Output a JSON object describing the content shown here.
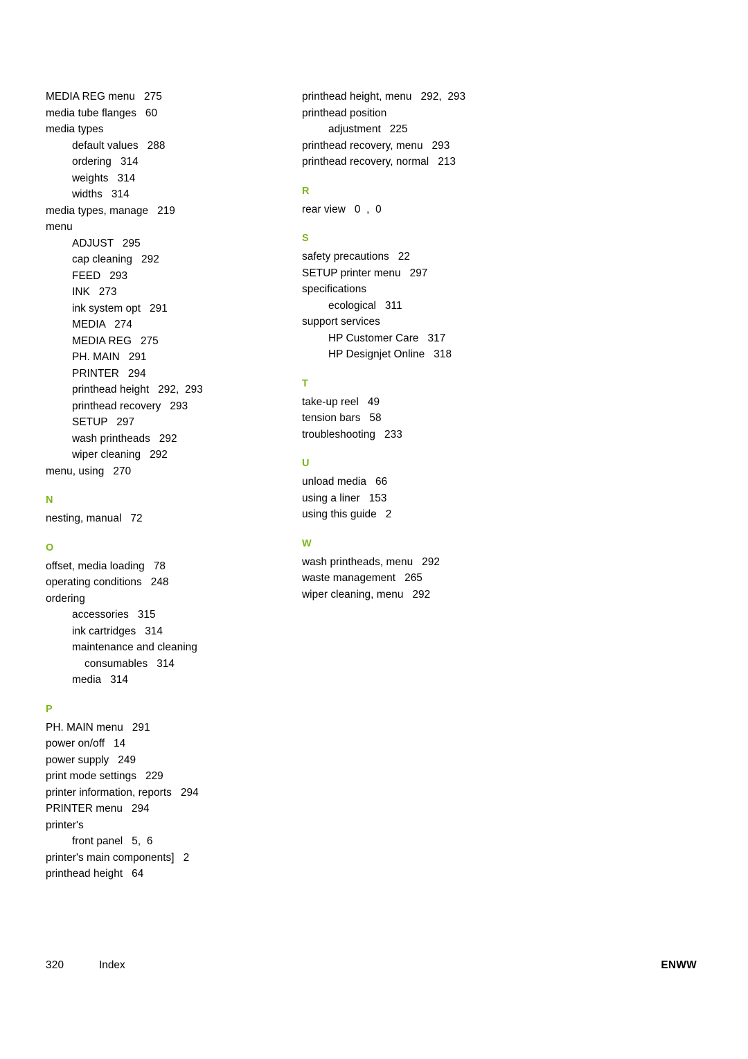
{
  "document": {
    "footer": {
      "page_number": "320",
      "label": "Index",
      "right": "ENWW"
    },
    "accent_color": "#7cb518"
  },
  "columns": [
    {
      "name": "left-column",
      "blocks": [
        {
          "letter": "",
          "entries": [
            {
              "text": "MEDIA REG menu   275",
              "level": 0
            },
            {
              "text": "media tube flanges   60",
              "level": 0
            },
            {
              "text": "media types",
              "level": 0
            },
            {
              "text": "default values   288",
              "level": 1
            },
            {
              "text": "ordering   314",
              "level": 1
            },
            {
              "text": "weights   314",
              "level": 1
            },
            {
              "text": "widths   314",
              "level": 1
            },
            {
              "text": "media types, manage   219",
              "level": 0
            },
            {
              "text": "menu",
              "level": 0
            },
            {
              "text": "ADJUST   295",
              "level": 1
            },
            {
              "text": "cap cleaning   292",
              "level": 1
            },
            {
              "text": "FEED   293",
              "level": 1
            },
            {
              "text": "INK   273",
              "level": 1
            },
            {
              "text": "ink system opt   291",
              "level": 1
            },
            {
              "text": "MEDIA   274",
              "level": 1
            },
            {
              "text": "MEDIA REG   275",
              "level": 1
            },
            {
              "text": "PH. MAIN   291",
              "level": 1
            },
            {
              "text": "PRINTER   294",
              "level": 1
            },
            {
              "text": "printhead height   292,  293",
              "level": 1
            },
            {
              "text": "printhead recovery   293",
              "level": 1
            },
            {
              "text": "SETUP   297",
              "level": 1
            },
            {
              "text": "wash printheads   292",
              "level": 1
            },
            {
              "text": "wiper cleaning   292",
              "level": 1
            },
            {
              "text": "menu, using   270",
              "level": 0
            }
          ]
        },
        {
          "letter": "N",
          "entries": [
            {
              "text": "nesting, manual   72",
              "level": 0
            }
          ]
        },
        {
          "letter": "O",
          "entries": [
            {
              "text": "offset, media loading   78",
              "level": 0
            },
            {
              "text": "operating conditions   248",
              "level": 0
            },
            {
              "text": "ordering",
              "level": 0
            },
            {
              "text": "accessories   315",
              "level": 1
            },
            {
              "text": "ink cartridges   314",
              "level": 1
            },
            {
              "text": "maintenance and cleaning",
              "level": 1
            },
            {
              "text": "consumables   314",
              "level": 2
            },
            {
              "text": "media   314",
              "level": 1
            }
          ]
        },
        {
          "letter": "P",
          "entries": [
            {
              "text": "PH. MAIN menu   291",
              "level": 0
            },
            {
              "text": "power on/off   14",
              "level": 0
            },
            {
              "text": "power supply   249",
              "level": 0
            },
            {
              "text": "print mode settings   229",
              "level": 0
            },
            {
              "text": "printer information, reports   294",
              "level": 0
            },
            {
              "text": "PRINTER menu   294",
              "level": 0
            },
            {
              "text": "printer's",
              "level": 0
            },
            {
              "text": "front panel   5,  6",
              "level": 1
            },
            {
              "text": "printer's main components]   2",
              "level": 0
            },
            {
              "text": "printhead height   64",
              "level": 0
            }
          ]
        }
      ]
    },
    {
      "name": "right-column",
      "blocks": [
        {
          "letter": "",
          "entries": [
            {
              "text": "printhead height, menu   292,  293",
              "level": 0
            },
            {
              "text": "printhead position",
              "level": 0
            },
            {
              "text": "adjustment   225",
              "level": 1
            },
            {
              "text": "printhead recovery, menu   293",
              "level": 0
            },
            {
              "text": "printhead recovery, normal   213",
              "level": 0
            }
          ]
        },
        {
          "letter": "R",
          "entries": [
            {
              "text": "rear view   0  ,  0",
              "level": 0
            }
          ]
        },
        {
          "letter": "S",
          "entries": [
            {
              "text": "safety precautions   22",
              "level": 0
            },
            {
              "text": "SETUP printer menu   297",
              "level": 0
            },
            {
              "text": "specifications",
              "level": 0
            },
            {
              "text": "ecological   311",
              "level": 1
            },
            {
              "text": "support services",
              "level": 0
            },
            {
              "text": "HP Customer Care   317",
              "level": 1
            },
            {
              "text": "HP Designjet Online   318",
              "level": 1
            }
          ]
        },
        {
          "letter": "T",
          "entries": [
            {
              "text": "take-up reel   49",
              "level": 0
            },
            {
              "text": "tension bars   58",
              "level": 0
            },
            {
              "text": "troubleshooting   233",
              "level": 0
            }
          ]
        },
        {
          "letter": "U",
          "entries": [
            {
              "text": "unload media   66",
              "level": 0
            },
            {
              "text": "using a liner   153",
              "level": 0
            },
            {
              "text": "using this guide   2",
              "level": 0
            }
          ]
        },
        {
          "letter": "W",
          "entries": [
            {
              "text": "wash printheads, menu   292",
              "level": 0
            },
            {
              "text": "waste management   265",
              "level": 0
            },
            {
              "text": "wiper cleaning, menu   292",
              "level": 0
            }
          ]
        }
      ]
    }
  ]
}
